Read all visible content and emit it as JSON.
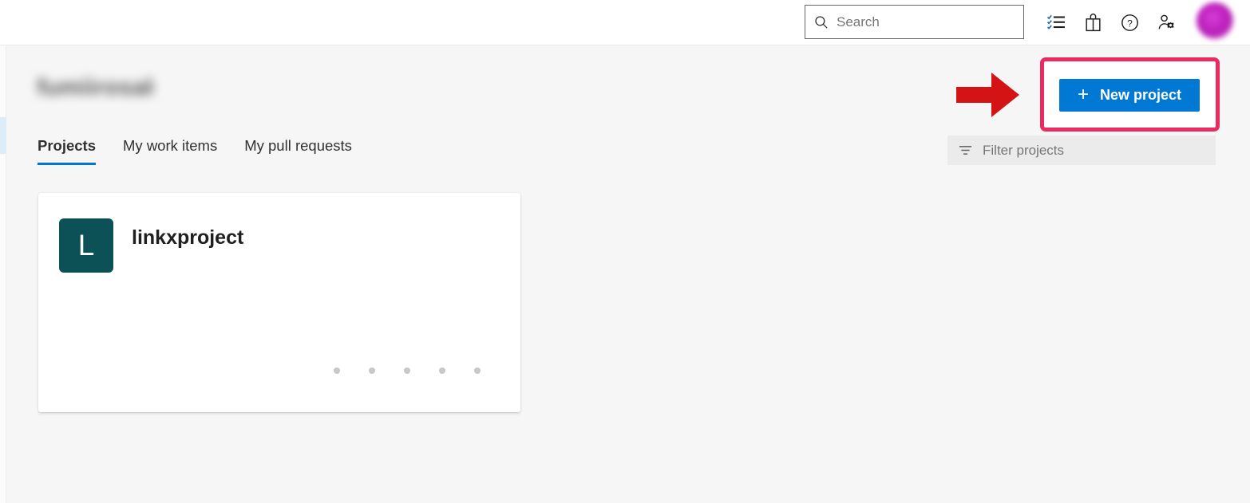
{
  "header": {
    "search": {
      "placeholder": "Search",
      "value": "",
      "icon": "search-icon"
    },
    "icons": [
      {
        "name": "checklist-icon",
        "label": "Work items"
      },
      {
        "name": "marketplace-bag-icon",
        "label": "Marketplace"
      },
      {
        "name": "help-circle-icon",
        "label": "Help"
      },
      {
        "name": "user-settings-icon",
        "label": "User settings"
      }
    ],
    "avatar": {
      "name": "user-avatar",
      "label": ""
    }
  },
  "page": {
    "org_title": "fumiirosaka",
    "tabs": [
      {
        "label": "Projects",
        "active": true
      },
      {
        "label": "My work items",
        "active": false
      },
      {
        "label": "My pull requests",
        "active": false
      }
    ],
    "new_project_button": {
      "label": "New project",
      "plus": "+"
    },
    "filter": {
      "placeholder": "Filter projects",
      "value": "",
      "icon": "filter-icon"
    }
  },
  "projects": [
    {
      "initial": "L",
      "name": "linkxproject",
      "avatar_color": "#0b5155",
      "dots": 5
    }
  ],
  "annotations": {
    "arrow": {
      "name": "red-arrow-annotation",
      "color": "#d41414",
      "direction": "right"
    },
    "highlight": {
      "name": "pink-highlight-annotation",
      "color": "#ec2a62",
      "target": "New project"
    }
  },
  "colors": {
    "accent_blue": "#0078d4",
    "page_background": "#f6f6f6",
    "header_background": "#ffffff",
    "card_background": "#ffffff",
    "project_avatar": "#0b5155",
    "annotation_red": "#d41414",
    "annotation_pink": "#ec2a62"
  }
}
